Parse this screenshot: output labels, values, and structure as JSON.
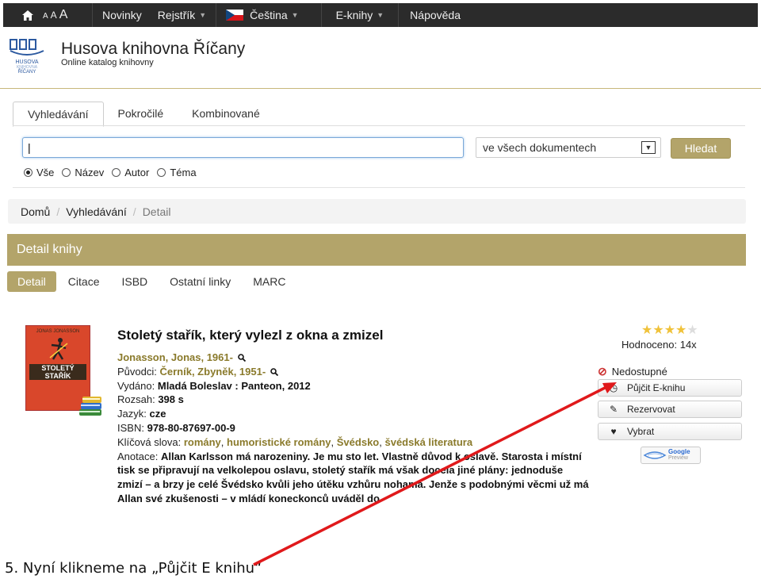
{
  "topnav": {
    "font_sizes": [
      "A",
      "A",
      "A"
    ],
    "items": [
      {
        "label": "Novinky",
        "caret": false
      },
      {
        "label": "Rejstřík",
        "caret": true
      },
      {
        "label": "Čeština",
        "caret": true
      },
      {
        "label": "E-knihy",
        "caret": true
      },
      {
        "label": "Nápověda",
        "caret": false
      }
    ]
  },
  "header": {
    "title": "Husova knihovna Říčany",
    "subtitle": "Online katalog knihovny"
  },
  "search": {
    "tabs": [
      "Vyhledávání",
      "Pokročilé",
      "Kombinované"
    ],
    "input_value": "|",
    "scope": "ve všech dokumentech",
    "button": "Hledat",
    "radios": [
      "Vše",
      "Název",
      "Autor",
      "Téma"
    ]
  },
  "breadcrumb": [
    "Domů",
    "Vyhledávání",
    "Detail"
  ],
  "detail": {
    "bar_title": "Detail knihy",
    "subtabs": [
      "Detail",
      "Citace",
      "ISBD",
      "Ostatní linky",
      "MARC"
    ]
  },
  "cover": {
    "author": "JONAS JONASSON",
    "title": "STOLETÝ STAŘÍK"
  },
  "book": {
    "title": "Stoletý stařík, který vylezl z okna a zmizel",
    "author": "Jonasson, Jonas, 1961-",
    "original_label": "Původci:",
    "original": "Černík, Zbyněk, 1951-",
    "published_label": "Vydáno:",
    "published": "Mladá Boleslav : Panteon, 2012",
    "extent_label": "Rozsah:",
    "extent": "398 s",
    "language_label": "Jazyk:",
    "language": "cze",
    "isbn_label": "ISBN:",
    "isbn": "978-80-87697-00-9",
    "keywords_label": "Klíčová slova:",
    "keywords": [
      "romány",
      "humoristické romány",
      "Švédsko",
      "švédská literatura"
    ],
    "annotation_label": "Anotace:",
    "annotation": "Allan Karlsson má narozeniny. Je mu sto let. Vlastně důvod k oslavě. Starosta i místní tisk se připravují na velkolepou oslavu, stoletý stařík má však docela jiné plány: jednoduše zmizí – a brzy je celé Švédsko kvůli jeho útěku vzhůru nohama. Jenže s podobnými věcmi už má Allan své zkušenosti – v mládí koneckonců uváděl do"
  },
  "side": {
    "rating": 4,
    "rating_max": 5,
    "rated_text": "Hodnoceno: 14x",
    "status": "Nedostupné",
    "buttons": [
      "Půjčit E-knihu",
      "Rezervovat",
      "Vybrat"
    ],
    "google_preview": [
      "Google",
      "Preview"
    ]
  },
  "caption": "5. Nyní klikneme na „Půjčit E knihu“",
  "colors": {
    "accent": "#b3a46a",
    "link": "#8a7a2b",
    "arrow": "#e0191b"
  }
}
